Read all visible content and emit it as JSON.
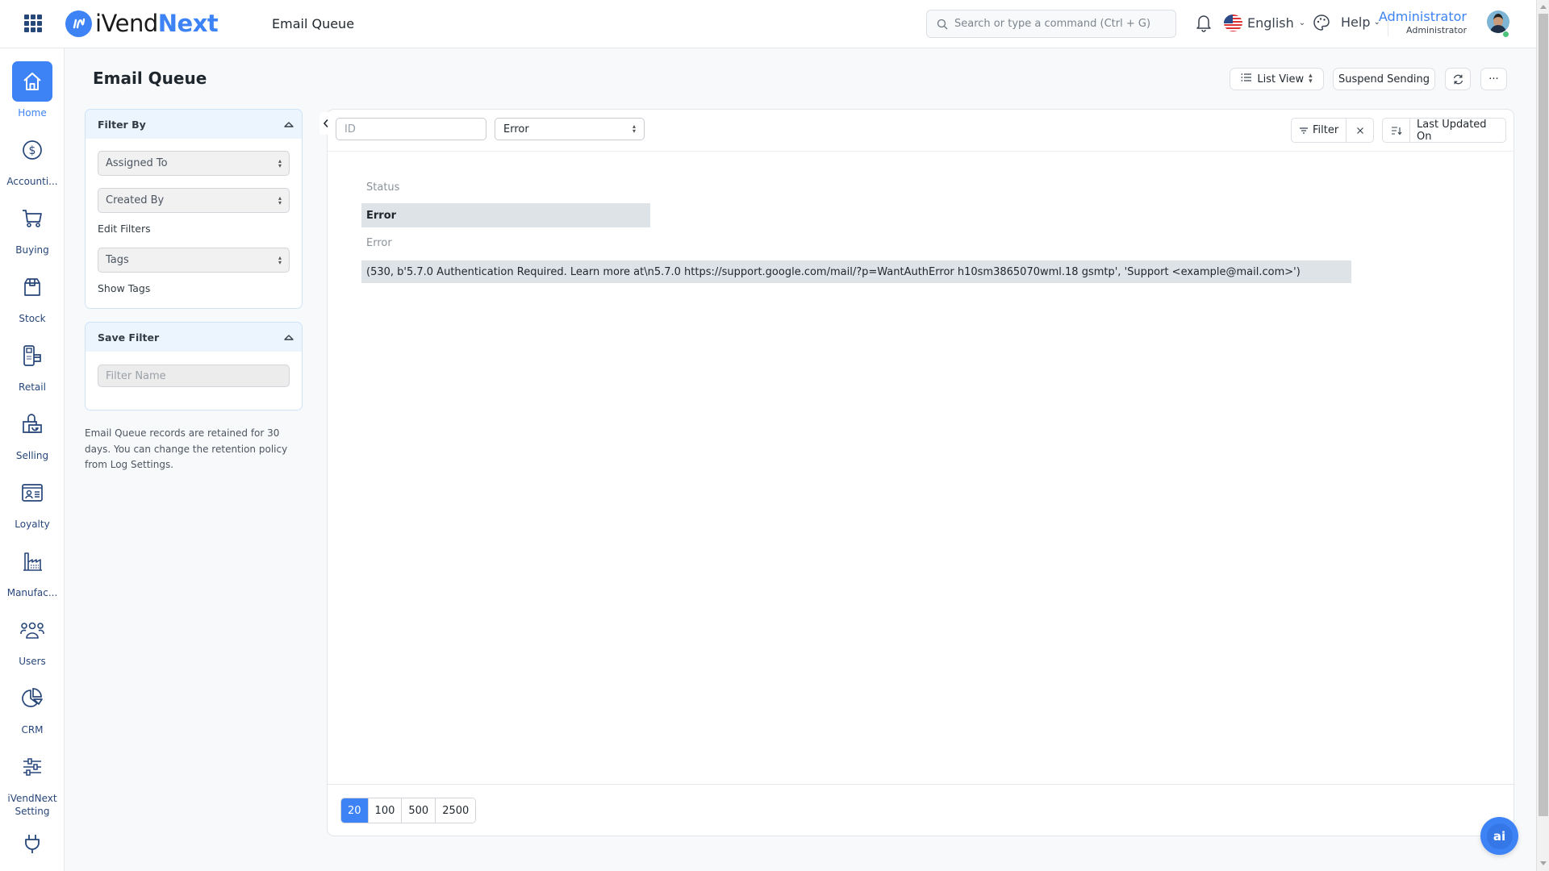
{
  "topbar": {
    "app_name_part1": "iVend",
    "app_name_part2": "Next",
    "breadcrumb": "Email Queue",
    "search_placeholder": "Search or type a command (Ctrl + G)",
    "language": "English",
    "help": "Help",
    "user_name": "Administrator",
    "user_role": "Administrator"
  },
  "sidebar": {
    "items": [
      {
        "label": "Home",
        "icon": "home-icon",
        "active": true
      },
      {
        "label": "Accounti...",
        "icon": "dollar-icon"
      },
      {
        "label": "Buying",
        "icon": "cart-icon"
      },
      {
        "label": "Stock",
        "icon": "box-icon"
      },
      {
        "label": "Retail",
        "icon": "pos-terminal-icon"
      },
      {
        "label": "Selling",
        "icon": "shopping-bag-icon"
      },
      {
        "label": "Loyalty",
        "icon": "id-card-icon"
      },
      {
        "label": "Manufac...",
        "icon": "factory-icon"
      },
      {
        "label": "Users",
        "icon": "users-icon"
      },
      {
        "label": "CRM",
        "icon": "pie-chart-icon"
      },
      {
        "label": "iVendNext Setting",
        "icon": "sliders-icon"
      },
      {
        "label": "",
        "icon": "plug-icon"
      }
    ]
  },
  "page": {
    "title": "Email Queue",
    "list_view": "List View",
    "suspend_sending": "Suspend Sending",
    "more": "···"
  },
  "filter_sidebar": {
    "filter_by_title": "Filter By",
    "assigned_to": "Assigned To",
    "created_by": "Created By",
    "edit_filters": "Edit Filters",
    "tags": "Tags",
    "show_tags": "Show Tags",
    "save_filter_title": "Save Filter",
    "filter_name_placeholder": "Filter Name",
    "retention_note": "Email Queue records are retained for 30 days. You can change the retention policy from Log Settings."
  },
  "toolbar": {
    "id_placeholder": "ID",
    "status_filter": "Error",
    "filter_label": "Filter",
    "sort_label": "Last Updated On"
  },
  "record": {
    "status_label": "Status",
    "status_value": "Error",
    "error_label": "Error",
    "error_value": "(530, b'5.7.0 Authentication Required. Learn more at\\n5.7.0 https://support.google.com/mail/?p=WantAuthError h10sm3865070wml.18 gsmtp', 'Support <example@mail.com>')"
  },
  "pagination": {
    "options": [
      "20",
      "100",
      "500",
      "2500"
    ],
    "selected": "20"
  },
  "assistant": {
    "label": "ai"
  },
  "colors": {
    "accent": "#3d83f5",
    "nav_icon": "#27467a",
    "value_bg": "#dde3e6"
  }
}
